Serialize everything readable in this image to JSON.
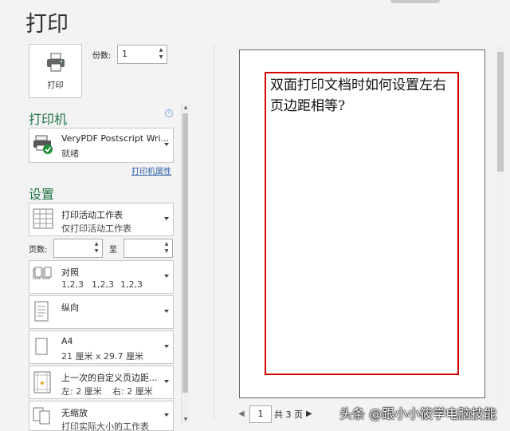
{
  "title": "打印",
  "print_button": {
    "label": "打印"
  },
  "copies": {
    "label": "份数:",
    "value": "1"
  },
  "printer_section": {
    "heading": "打印机",
    "info": "i",
    "printer_name": "VeryPDF Postscript Wri...",
    "printer_status": "就绪",
    "properties_link": "打印机属性"
  },
  "settings_section": {
    "heading": "设置",
    "scope": {
      "line1": "打印活动工作表",
      "line2": "仅打印活动工作表"
    },
    "pages": {
      "label": "页数:",
      "to_label": "至",
      "from_value": "",
      "to_value": ""
    },
    "collate": {
      "line1": "对照",
      "line2": [
        "1,2,3",
        "1,2,3",
        "1,2,3"
      ]
    },
    "orientation": {
      "line1": "纵向"
    },
    "paper": {
      "line1": "A4",
      "line2": "21 厘米 x 29.7 厘米"
    },
    "margins": {
      "line1": "上一次的自定义页边距...",
      "left": "左: 2 厘米",
      "right": "右: 2 厘米"
    },
    "scaling": {
      "line1": "无缩放",
      "line2": "打印实际大小的工作表"
    }
  },
  "preview": {
    "text": "双面打印文档时如何设置左右页边距相等?"
  },
  "pager": {
    "current": "1",
    "total_text": "共 3 页"
  },
  "watermark": "头条 @跟小小筱学电脑技能"
}
